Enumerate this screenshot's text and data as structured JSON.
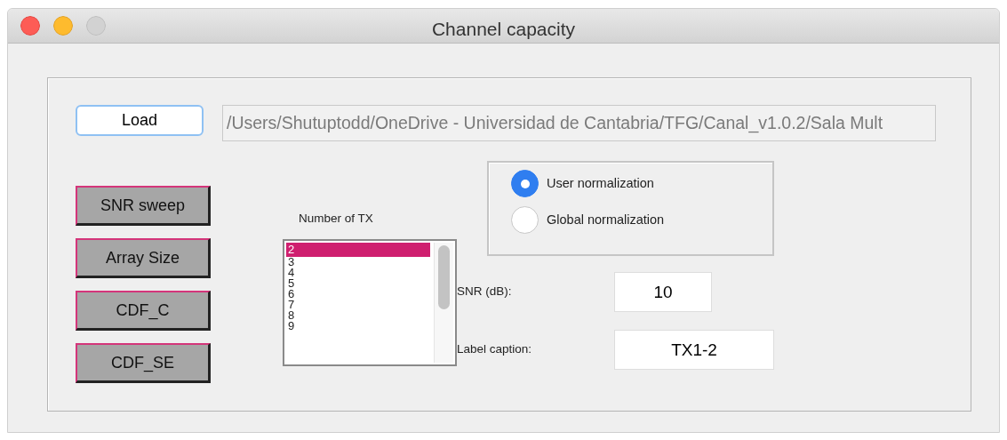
{
  "window": {
    "title": "Channel capacity"
  },
  "load_button": {
    "label": "Load"
  },
  "file_path": {
    "value": "/Users/Shutuptodd/OneDrive - Universidad de Cantabria/TFG/Canal_v1.0.2/Sala Mult"
  },
  "action_buttons": [
    {
      "label": "SNR sweep"
    },
    {
      "label": "Array Size"
    },
    {
      "label": "CDF_C"
    },
    {
      "label": "CDF_SE"
    }
  ],
  "tx_list": {
    "label": "Number of TX",
    "items": [
      {
        "text": "2",
        "selected": true
      },
      {
        "text": "3",
        "selected": false
      },
      {
        "text": "4",
        "selected": false
      },
      {
        "text": "5",
        "selected": false
      },
      {
        "text": "6",
        "selected": false
      },
      {
        "text": "7",
        "selected": false
      },
      {
        "text": "8",
        "selected": false
      },
      {
        "text": "9",
        "selected": false
      }
    ]
  },
  "normalization": [
    {
      "label": "User normalization",
      "selected": true
    },
    {
      "label": "Global normalization",
      "selected": false
    }
  ],
  "fields": [
    {
      "label": "SNR (dB):",
      "value": "10"
    },
    {
      "label": "Label caption:",
      "value": "TX1-2"
    }
  ]
}
